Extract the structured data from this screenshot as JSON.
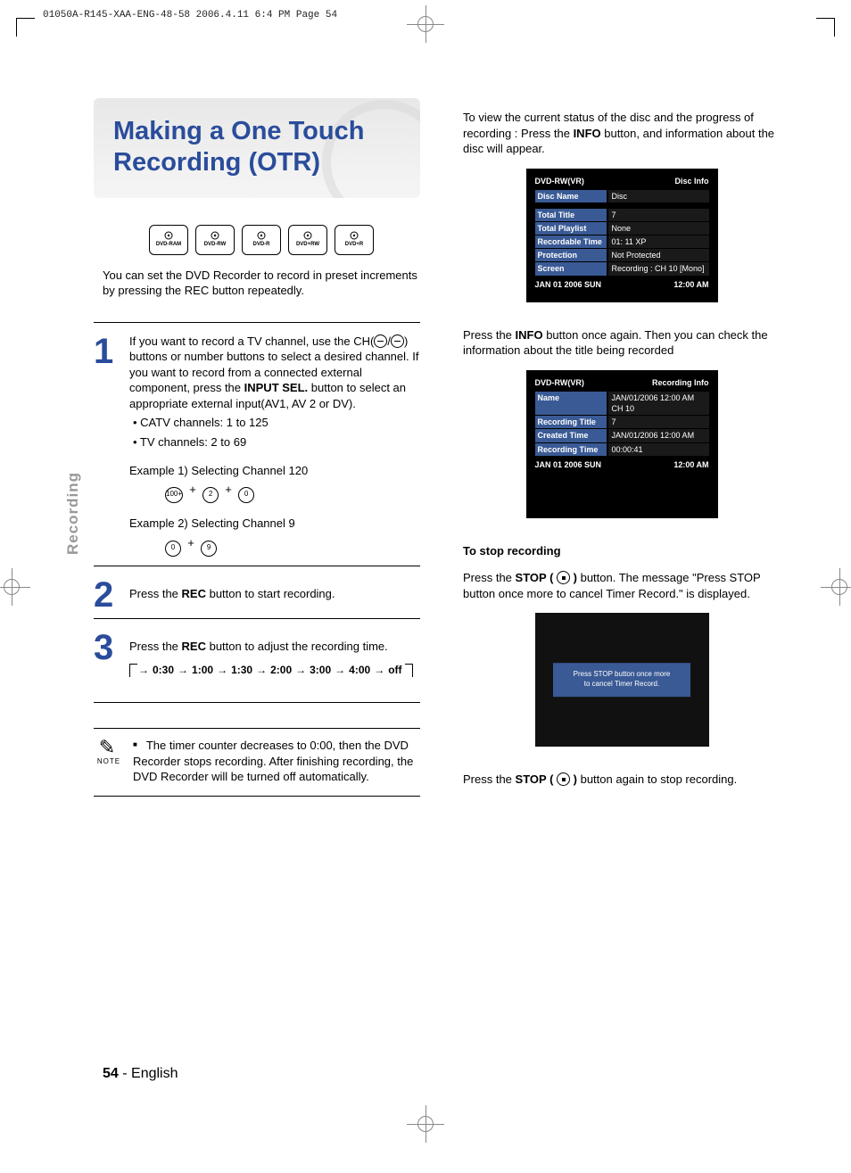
{
  "meta": {
    "print_header": "01050A-R145-XAA-ENG-48-58  2006.4.11  6:4 PM  Page 54"
  },
  "sidecap": "Recording",
  "title": "Making a One Touch Recording (OTR)",
  "badges": [
    "DVD-RAM",
    "DVD-RW",
    "DVD-R",
    "DVD+RW",
    "DVD+R"
  ],
  "intro": "You can set the DVD Recorder to record in preset increments by pressing the REC button repeatedly.",
  "step1": {
    "line1_pre": "If you want to record a TV channel, use the CH(",
    "line1_post": ") buttons or number buttons to select a desired channel. If you want to record from a connected external component, press the ",
    "inputsel": "INPUT SEL.",
    "line1_end": " button to select an appropriate external input(AV1, AV 2 or DV).",
    "catv": "• CATV channels: 1 to 125",
    "tv": "• TV channels: 2 to 69",
    "ex1": "Example 1) Selecting Channel 120",
    "ex2": "Example 2) Selecting Channel 9"
  },
  "step2": {
    "pre": "Press the ",
    "rec": "REC",
    "post": " button to start recording."
  },
  "step3": {
    "pre": "Press the ",
    "rec": "REC",
    "post": " button to adjust the recording time."
  },
  "times": [
    "0:30",
    "1:00",
    "1:30",
    "2:00",
    "3:00",
    "4:00",
    "off"
  ],
  "note": {
    "label": "NOTE",
    "text": "The timer counter decreases to 0:00, then the DVD Recorder stops recording. After finishing recording, the DVD Recorder will be turned off automatically."
  },
  "right": {
    "p1_pre": "To view the current status of the disc and the progress of recording : Press the ",
    "info": "INFO",
    "p1_post": " button, and information about the disc will appear.",
    "p2_pre": "Press the ",
    "p2_post": " button once again. Then you can check the information about the title being recorded",
    "stop_head": "To stop recording",
    "stop_p1_pre": "Press the ",
    "stop_label": "STOP (",
    "stop_close": " )",
    "stop_p1_post": " button. The message \"Press STOP button once more to cancel Timer Record.\" is displayed.",
    "stop_p2_pre": "Press the ",
    "stop_p2_post": " button again to stop recording."
  },
  "osd1": {
    "type": "DVD-RW(VR)",
    "head": "Disc Info",
    "rows": [
      [
        "Disc Name",
        "Disc"
      ],
      [
        "Total Title",
        "7"
      ],
      [
        "Total Playlist",
        "None"
      ],
      [
        "Recordable Time",
        "01: 11 XP"
      ],
      [
        "Protection",
        "Not Protected"
      ],
      [
        "Screen",
        "Recording : CH 10 [Mono]"
      ]
    ],
    "foot_l": "JAN 01 2006 SUN",
    "foot_r": "12:00 AM"
  },
  "osd2": {
    "type": "DVD-RW(VR)",
    "head": "Recording Info",
    "rows": [
      [
        "Name",
        "JAN/01/2006 12:00 AM CH 10"
      ],
      [
        "Recording Title",
        "7"
      ],
      [
        "Created Time",
        "JAN/01/2006 12:00 AM"
      ],
      [
        "Recording Time",
        "00:00:41"
      ]
    ],
    "foot_l": "JAN 01 2006 SUN",
    "foot_r": "12:00 AM"
  },
  "osd3": {
    "msg1": "Press STOP button once more",
    "msg2": "to cancel Timer Record."
  },
  "footer": {
    "page": "54",
    "lang": "English"
  }
}
